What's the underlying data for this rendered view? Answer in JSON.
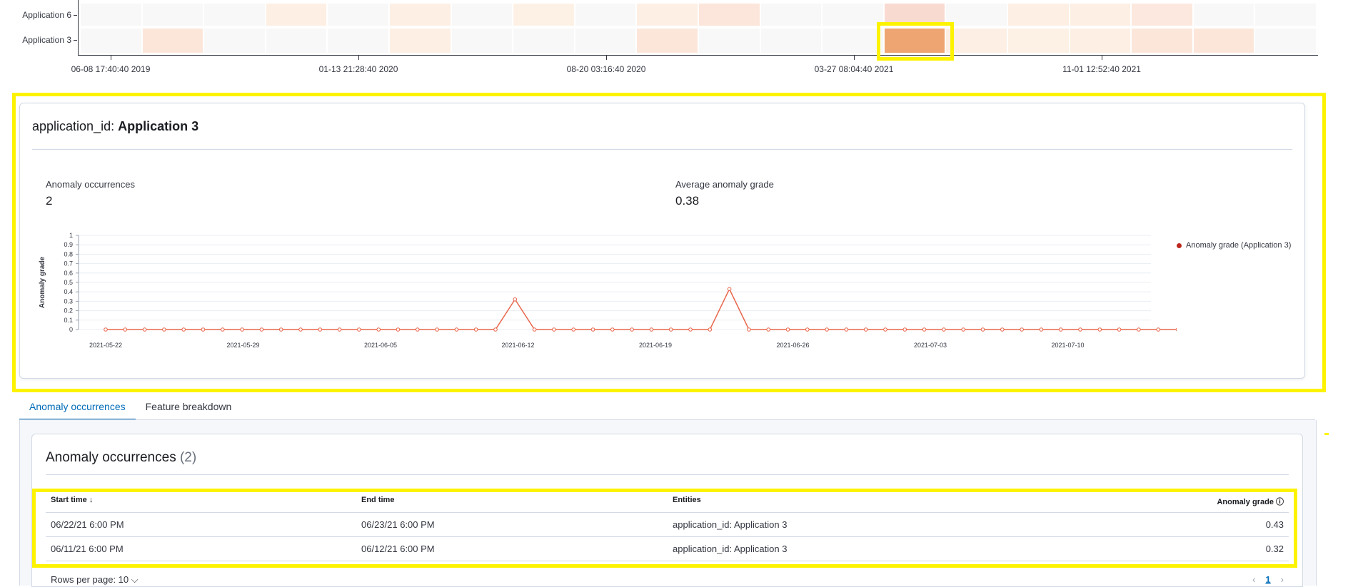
{
  "heatmap": {
    "rows": [
      "Application 6",
      "Application 3"
    ],
    "x_ticks": [
      "06-08 17:40:40 2019",
      "01-13 21:28:40 2020",
      "08-20 03:16:40 2020",
      "03-27 08:04:40 2021",
      "11-01 12:52:40 2021"
    ],
    "row_cells": [
      [
        "#f8f8f8",
        "#f8f8f8",
        "#f8f8f8",
        "#fdefe3",
        "#f8f8f8",
        "#fdefe3",
        "#f8f8f8",
        "#fdf1e6",
        "#f8f8f8",
        "#fdefe3",
        "#fce6db",
        "#f8f8f8",
        "#f8f8f8",
        "#f9dad1",
        "#f8f8f8",
        "#fdefe3",
        "#fdefe3",
        "#fce8de",
        "#f8f8f8",
        "#f8f8f8"
      ],
      [
        "#f8f8f8",
        "#fce6da",
        "#f8f8f8",
        "#f8f8f8",
        "#f8f8f8",
        "#fdefe3",
        "#f8f8f8",
        "#f8f8f8",
        "#f8f8f8",
        "#fce6da",
        "#f8f8f8",
        "#f8f8f8",
        "#f8f8f8",
        "#eea572",
        "#fdefe3",
        "#fdf1e6",
        "#fdefe3",
        "#fce6da",
        "#fce6da",
        "#f8f8f8"
      ]
    ],
    "highlight_color": "#fdf300"
  },
  "detail": {
    "title_key": "application_id:",
    "title_value": "Application 3",
    "stat1_label": "Anomaly occurrences",
    "stat1_value": "2",
    "stat2_label": "Average anomaly grade",
    "stat2_value": "0.38",
    "legend_label": "Anomaly grade (Application 3)"
  },
  "chart_data": {
    "type": "line",
    "ylabel": "Anomaly grade",
    "ylim": [
      0,
      1
    ],
    "yticks": [
      "0",
      "0.1",
      "0.2",
      "0.3",
      "0.4",
      "0.5",
      "0.6",
      "0.7",
      "0.8",
      "0.9",
      "1"
    ],
    "x_tick_labels": [
      "2021-05-22",
      "2021-05-29",
      "2021-06-05",
      "2021-06-12",
      "2021-06-19",
      "2021-06-26",
      "2021-07-03",
      "2021-07-10"
    ],
    "series": [
      {
        "name": "Anomaly grade (Application 3)",
        "color": "#e7664c",
        "values": [
          0,
          0,
          0,
          0,
          0,
          0,
          0,
          0,
          0,
          0,
          0,
          0,
          0,
          0,
          0,
          0,
          0,
          0,
          0,
          0,
          0,
          0.32,
          0,
          0,
          0,
          0,
          0,
          0,
          0,
          0,
          0,
          0,
          0.43,
          0,
          0,
          0,
          0,
          0,
          0,
          0,
          0,
          0,
          0,
          0,
          0,
          0,
          0,
          0,
          0,
          0,
          0,
          0,
          0,
          0,
          0,
          0
        ]
      }
    ]
  },
  "tabs": [
    {
      "label": "Anomaly occurrences",
      "active": true
    },
    {
      "label": "Feature breakdown",
      "active": false
    }
  ],
  "table": {
    "title": "Anomaly occurrences",
    "count": "(2)",
    "columns": [
      "Start time",
      "End time",
      "Entities",
      "Anomaly grade"
    ],
    "sort_arrow": "↓",
    "info_icon": "ⓘ",
    "rows": [
      [
        "06/22/21 6:00 PM",
        "06/23/21 6:00 PM",
        "application_id: Application 3",
        "0.43"
      ],
      [
        "06/11/21 6:00 PM",
        "06/12/21 6:00 PM",
        "application_id: Application 3",
        "0.32"
      ]
    ],
    "rows_per_page": "Rows per page: 10",
    "chevron": "⌵",
    "page_prev": "‹",
    "page_current": "1",
    "page_next": "›"
  }
}
